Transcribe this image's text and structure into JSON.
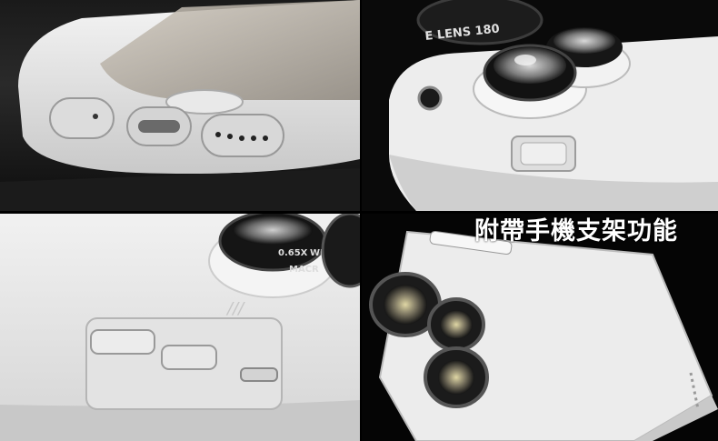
{
  "caption": "附帶手機支架功能",
  "lens_labels": {
    "fisheye": "E LENS 180",
    "wide": "0.65X",
    "wide_partial": "WI",
    "macro": "MACR"
  }
}
